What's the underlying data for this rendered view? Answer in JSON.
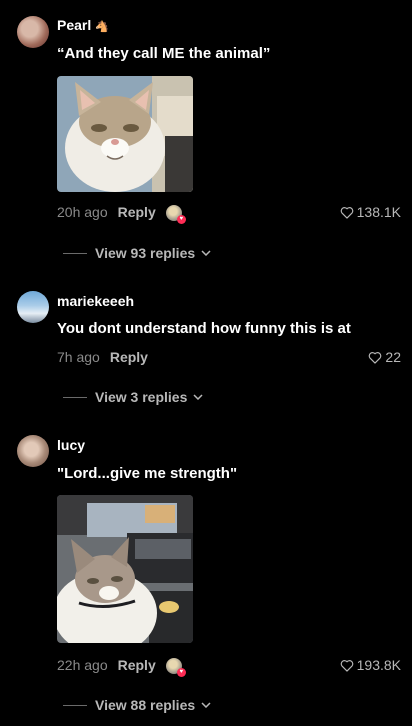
{
  "comments": [
    {
      "username": "Pearl",
      "badge_icon": "horse-emoji-icon",
      "text": "“And they call ME the animal”",
      "has_photo": true,
      "time": "20h ago",
      "reply_label": "Reply",
      "creator_liked": true,
      "likes": "138.1K",
      "view_replies": "View 93 replies"
    },
    {
      "username": "mariekeeeh",
      "text": "You dont understand how funny this is at",
      "has_photo": false,
      "time": "7h ago",
      "reply_label": "Reply",
      "creator_liked": false,
      "likes": "22",
      "view_replies": "View 3 replies"
    },
    {
      "username": "lucy",
      "text": "\"Lord...give me strength\"",
      "has_photo": true,
      "time": "22h ago",
      "reply_label": "Reply",
      "creator_liked": true,
      "likes": "193.8K",
      "view_replies": "View 88 replies"
    }
  ],
  "colors": {
    "background": "#000000",
    "text": "#ffffff",
    "muted": "#8a8a8a",
    "accent_like": "#fe2c55"
  }
}
